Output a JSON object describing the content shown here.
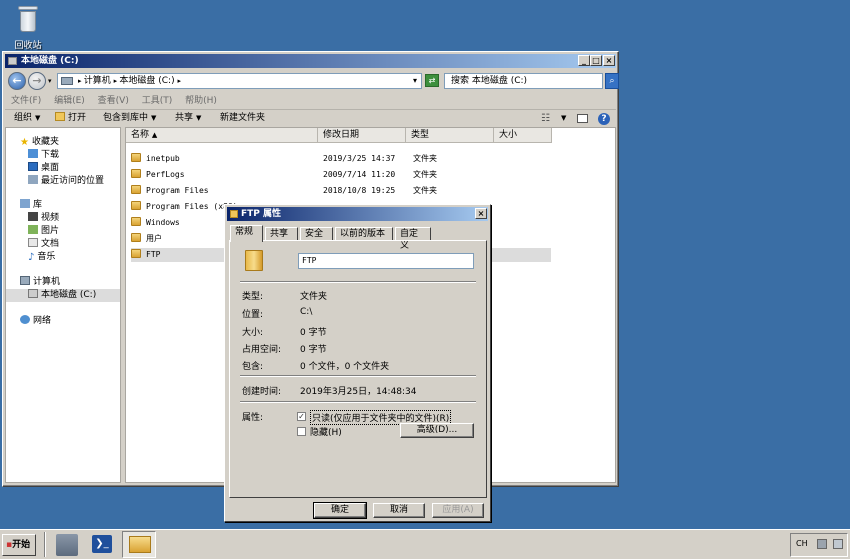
{
  "desktop": {
    "recycle_label": "回收站"
  },
  "explorer": {
    "title": "本地磁盘 (C:)",
    "breadcrumb": [
      "计算机",
      "本地磁盘 (C:)"
    ],
    "search_placeholder": "搜索 本地磁盘 (C:)",
    "menu": [
      "文件(F)",
      "编辑(E)",
      "查看(V)",
      "工具(T)",
      "帮助(H)"
    ],
    "toolbar": {
      "organize": "组织",
      "open": "打开",
      "include": "包含到库中",
      "share": "共享",
      "new_folder": "新建文件夹"
    },
    "nav": {
      "favorites": "收藏夹",
      "downloads": "下载",
      "desktop": "桌面",
      "recent": "最近访问的位置",
      "libraries": "库",
      "videos": "视频",
      "pictures": "图片",
      "documents": "文档",
      "music": "音乐",
      "computer": "计算机",
      "local_disk": "本地磁盘 (C:)",
      "network": "网络"
    },
    "columns": {
      "name": "名称",
      "modified": "修改日期",
      "type": "类型",
      "size": "大小"
    },
    "files": [
      {
        "name": "inetpub",
        "date": "2019/3/25 14:37",
        "type": "文件夹"
      },
      {
        "name": "PerfLogs",
        "date": "2009/7/14 11:20",
        "type": "文件夹"
      },
      {
        "name": "Program Files",
        "date": "2018/10/8 19:25",
        "type": "文件夹"
      },
      {
        "name": "Program Files (x86)",
        "date": "",
        "type": ""
      },
      {
        "name": "Windows",
        "date": "",
        "type": ""
      },
      {
        "name": "用户",
        "date": "",
        "type": ""
      },
      {
        "name": "FTP",
        "date": "",
        "type": ""
      }
    ]
  },
  "dialog": {
    "title": "FTP 属性",
    "tabs": [
      "常规",
      "共享",
      "安全",
      "以前的版本",
      "自定义"
    ],
    "folder_name": "FTP",
    "props": [
      {
        "label": "类型:",
        "value": "文件夹"
      },
      {
        "label": "位置:",
        "value": "C:\\"
      },
      {
        "label": "大小:",
        "value": "0 字节"
      },
      {
        "label": "占用空间:",
        "value": "0 字节"
      },
      {
        "label": "包含:",
        "value": "0 个文件，0 个文件夹"
      }
    ],
    "created_label": "创建时间:",
    "created_value": "2019年3月25日，14:48:34",
    "attr_label": "属性:",
    "readonly": "只读(仅应用于文件夹中的文件)(R)",
    "hidden": "隐藏(H)",
    "advanced": "高级(D)...",
    "ok": "确定",
    "cancel": "取消",
    "apply": "应用(A)"
  },
  "taskbar": {
    "start": "开始",
    "lang": "CH"
  },
  "colors": {
    "desktop": "#3a6ea5",
    "titlebar": "#0a246a",
    "face": "#d4d0c8"
  }
}
